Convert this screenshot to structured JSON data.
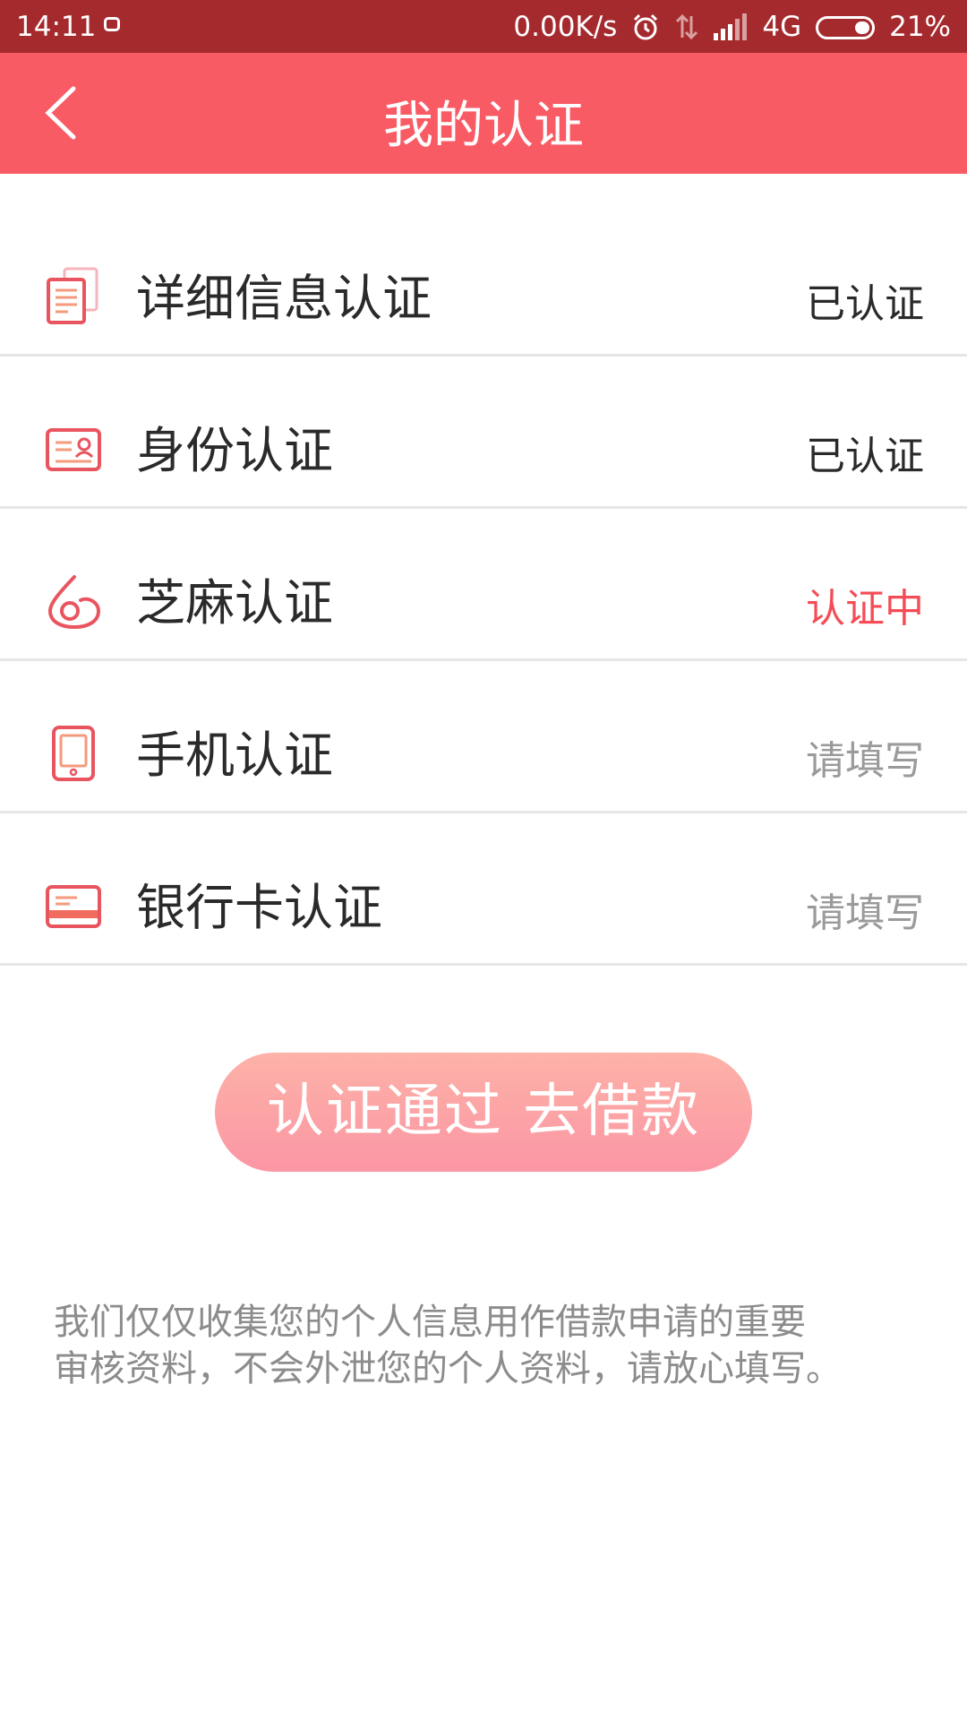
{
  "status_bar": {
    "time": "14:11",
    "network_speed": "0.00K/s",
    "network_type": "4G",
    "battery": "21%"
  },
  "header": {
    "title": "我的认证",
    "background": "#f95b65"
  },
  "items": [
    {
      "label": "详细信息认证",
      "status": "已认证",
      "status_color": "#2a2a2a",
      "icon": "document-icon"
    },
    {
      "label": "身份认证",
      "status": "已认证",
      "status_color": "#2a2a2a",
      "icon": "id-card-icon"
    },
    {
      "label": "芝麻认证",
      "status": "认证中",
      "status_color": "#f44c56",
      "icon": "sesame-icon"
    },
    {
      "label": "手机认证",
      "status": "请填写",
      "status_color": "#9a9a9a",
      "icon": "phone-icon"
    },
    {
      "label": "银行卡认证",
      "status": "请填写",
      "status_color": "#9a9a9a",
      "icon": "bank-card-icon"
    }
  ],
  "primary_button": {
    "label": "认证通过 去借款"
  },
  "note": {
    "line1": "我们仅仅收集您的个人信息用作借款申请的重要",
    "line2": "审核资料，不会外泄您的个人资料，请放心填写。"
  }
}
